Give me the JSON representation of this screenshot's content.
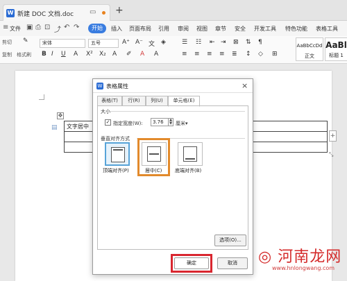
{
  "titlebar": {
    "tab_title": "新建 DOC 文档.doc",
    "doc_icon_letter": "W",
    "new_tab": "+"
  },
  "menu": {
    "file": "文件",
    "active": "开始",
    "items": [
      "插入",
      "页面布局",
      "引用",
      "审阅",
      "视图",
      "章节",
      "安全",
      "开发工具",
      "特色功能",
      "表格工具"
    ]
  },
  "ribbon": {
    "cut": "剪切",
    "copy": "复制",
    "format_painter": "格式刷",
    "paste": "粘贴",
    "font_name": "宋体",
    "font_size": "五号",
    "style1_preview": "AaBbCcDd",
    "style1_name": "正文",
    "style2_preview": "AaBl",
    "style2_name": "标题 1"
  },
  "document": {
    "cell_text": "文字居中"
  },
  "dialog": {
    "title": "表格属性",
    "icon_letter": "W",
    "close": "×",
    "tabs": [
      {
        "label": "表格(T)",
        "active": false
      },
      {
        "label": "行(R)",
        "active": false
      },
      {
        "label": "列(U)",
        "active": false
      },
      {
        "label": "单元格(E)",
        "active": true
      }
    ],
    "size_section": "大小",
    "width_checkbox_label": "指定宽度(W):",
    "width_checked": true,
    "width_value": "3.76",
    "width_unit": "厘米",
    "valign_section": "垂直对齐方式",
    "valign_options": [
      {
        "label": "顶端对齐(P)",
        "selected": true
      },
      {
        "label": "居中(C)",
        "selected": false
      },
      {
        "label": "底端对齐(B)",
        "selected": false
      }
    ],
    "options_button": "选项(O)...",
    "ok_button": "确定",
    "cancel_button": "取消"
  },
  "watermark": {
    "text": "◎ 河南龙网",
    "url": "www.hnlongwang.com"
  },
  "colors": {
    "accent": "#3a7de0",
    "highlight_orange": "#e28a2c",
    "highlight_red": "#d9262f",
    "selected_blue": "#57a3d8"
  }
}
